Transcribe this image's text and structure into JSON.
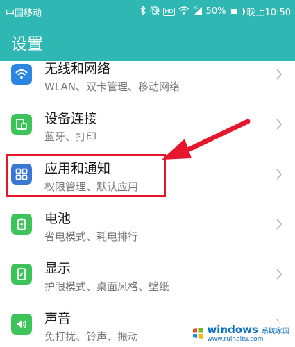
{
  "status_bar": {
    "carrier": "中国移动",
    "battery_percent_text": "50%",
    "battery_level": 0.5,
    "time": "晚上10:50",
    "icons": [
      "bluetooth-icon",
      "vibrate-icon",
      "hd-icon",
      "wifi-icon",
      "signal-4g-icon",
      "battery-icon"
    ]
  },
  "app_bar": {
    "title": "设置"
  },
  "items": [
    {
      "label": "无线和网络",
      "sub": "WLAN、双卡管理、移动网络",
      "icon": "wifi-icon",
      "color": "#2a86e0"
    },
    {
      "label": "设备连接",
      "sub": "蓝牙、打印",
      "icon": "device-connection-icon",
      "color": "#3cc45a"
    },
    {
      "label": "应用和通知",
      "sub": "权限管理、默认应用",
      "icon": "apps-grid-icon",
      "color": "#3a76d4"
    },
    {
      "label": "电池",
      "sub": "省电模式、耗电排行",
      "icon": "battery-icon",
      "color": "#3cc45a"
    },
    {
      "label": "显示",
      "sub": "护眼模式、桌面风格、壁纸",
      "icon": "display-icon",
      "color": "#3cc45a"
    },
    {
      "label": "声音",
      "sub": "免打扰、铃声、振动",
      "icon": "sound-icon",
      "color": "#3cc45a"
    }
  ],
  "annotation": {
    "highlight_color": "#e6172d"
  },
  "watermark": {
    "main": "windows",
    "sub": "系统家园",
    "url": "www.ruihaitu.com"
  }
}
